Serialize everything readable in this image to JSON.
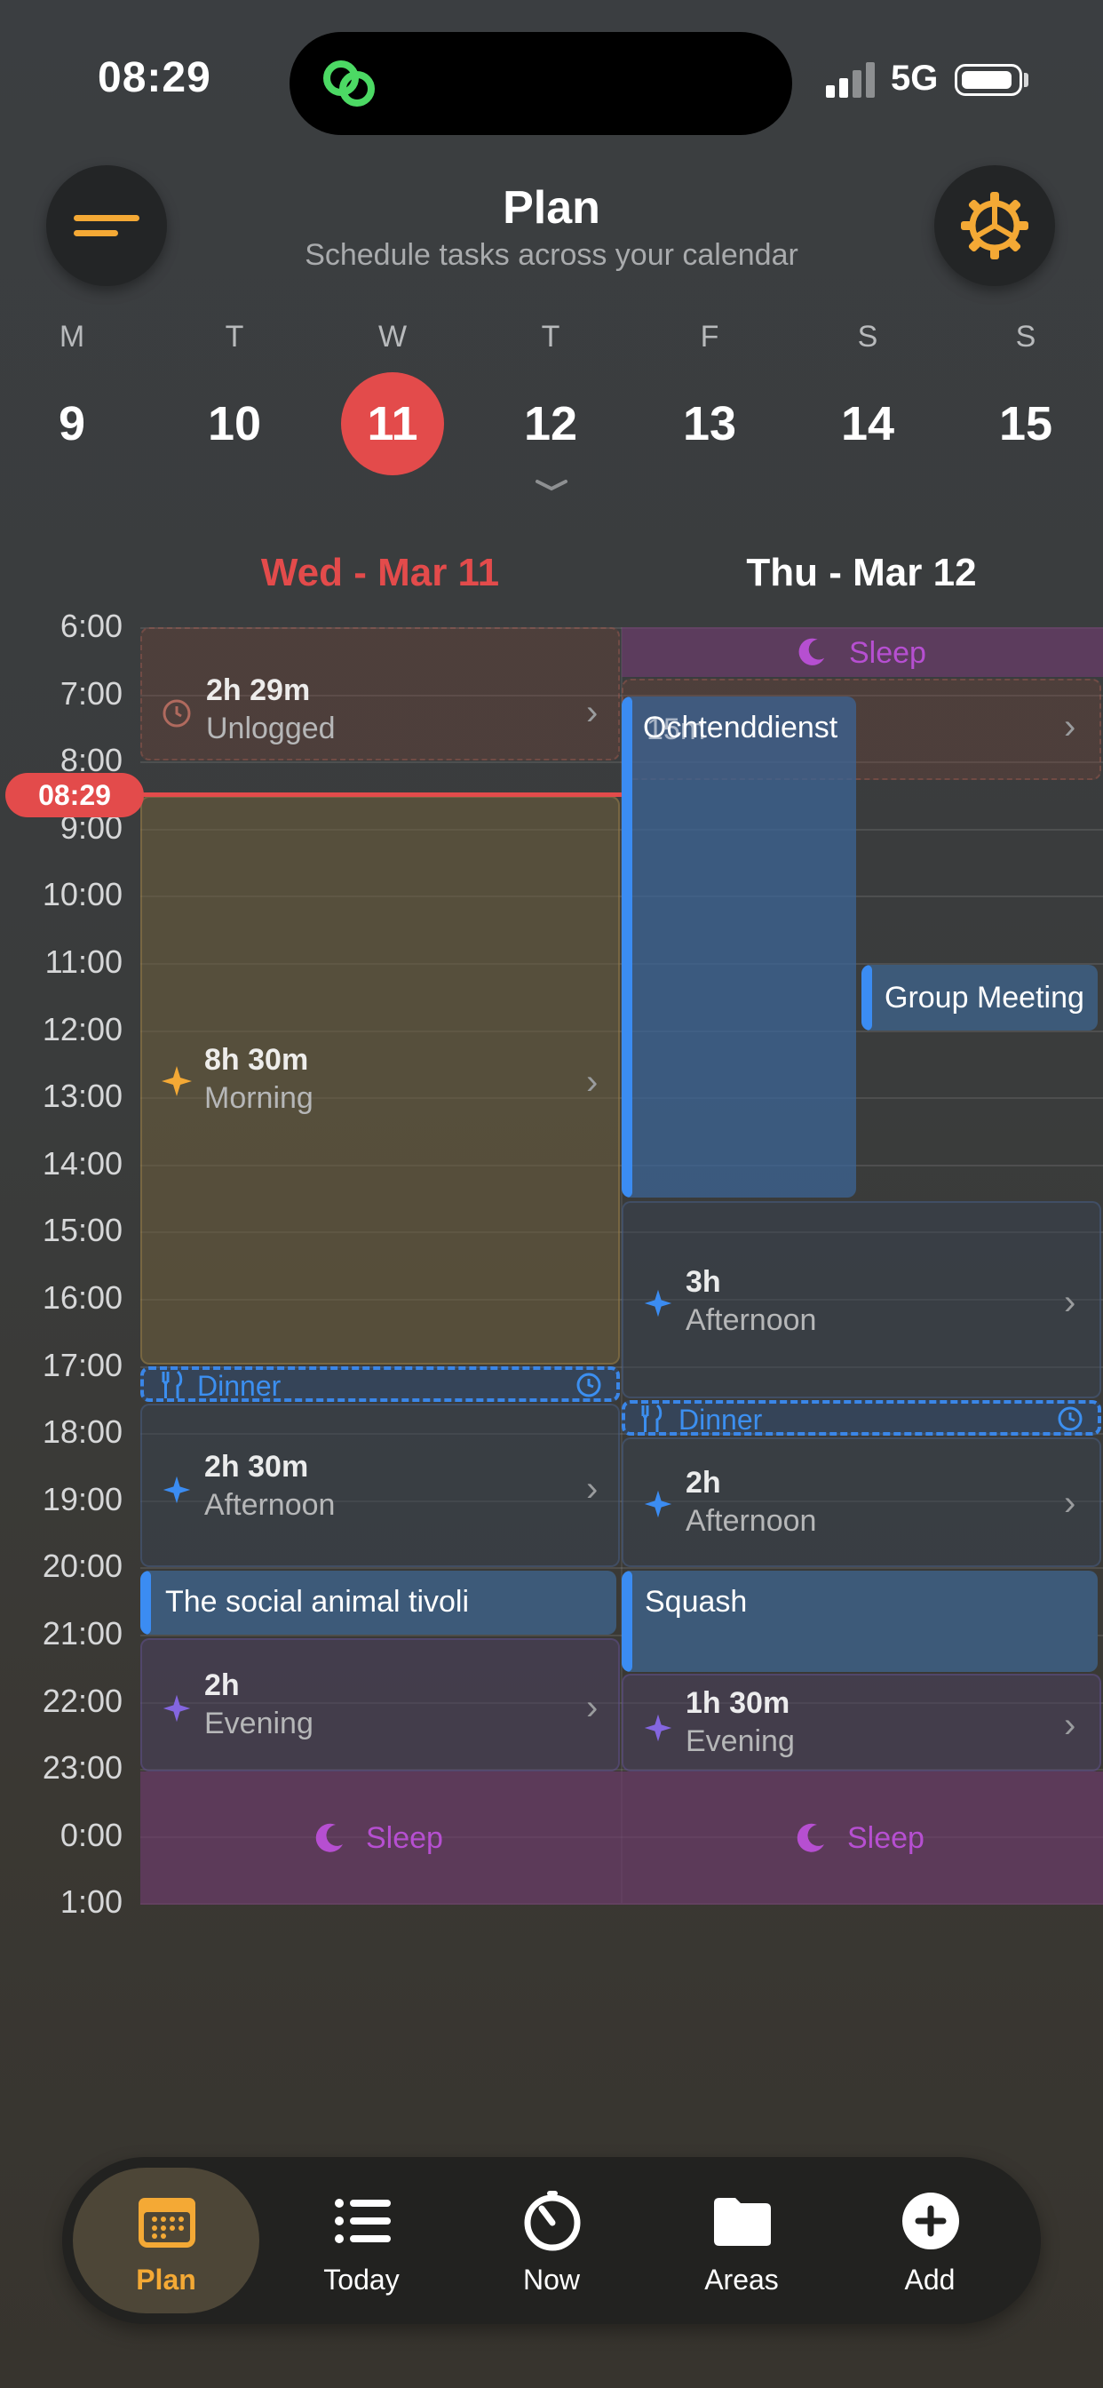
{
  "status": {
    "time": "08:29",
    "network": "5G"
  },
  "header": {
    "title": "Plan",
    "subtitle": "Schedule tasks across your calendar",
    "menu_icon": "menu-icon",
    "settings_icon": "gear-icon"
  },
  "week": [
    {
      "letter": "M",
      "num": "9"
    },
    {
      "letter": "T",
      "num": "10"
    },
    {
      "letter": "W",
      "num": "11",
      "selected": true
    },
    {
      "letter": "T",
      "num": "12"
    },
    {
      "letter": "F",
      "num": "13"
    },
    {
      "letter": "S",
      "num": "14"
    },
    {
      "letter": "S",
      "num": "15"
    }
  ],
  "days": {
    "left": "Wed - Mar 11",
    "right": "Thu - Mar 12"
  },
  "hours": [
    "6:00",
    "7:00",
    "8:00",
    "9:00",
    "10:00",
    "11:00",
    "12:00",
    "13:00",
    "14:00",
    "15:00",
    "16:00",
    "17:00",
    "18:00",
    "19:00",
    "20:00",
    "21:00",
    "22:00",
    "23:00",
    "0:00",
    "1:00"
  ],
  "now": "08:29",
  "wed": {
    "unlogged": {
      "duration": "2h 29m",
      "label": "Unlogged"
    },
    "morning": {
      "duration": "8h 30m",
      "label": "Morning"
    },
    "dinner": "Dinner",
    "afternoon": {
      "duration": "2h 30m",
      "label": "Afternoon"
    },
    "event": "The social animal tivoli",
    "evening": {
      "duration": "2h",
      "label": "Evening"
    },
    "sleep": "Sleep"
  },
  "thu": {
    "sleep_top": "Sleep",
    "event_long": "Ochtenddienst",
    "event_overlap": "15m",
    "group_meeting": "Group Meeting",
    "afternoon1": {
      "duration": "3h",
      "label": "Afternoon"
    },
    "dinner": "Dinner",
    "afternoon2": {
      "duration": "2h",
      "label": "Afternoon"
    },
    "event": "Squash",
    "evening": {
      "duration": "1h 30m",
      "label": "Evening"
    },
    "sleep": "Sleep"
  },
  "tabs": [
    {
      "label": "Plan",
      "icon": "calendar-icon",
      "selected": true
    },
    {
      "label": "Today",
      "icon": "list-icon"
    },
    {
      "label": "Now",
      "icon": "timer-icon"
    },
    {
      "label": "Areas",
      "icon": "folder-icon"
    },
    {
      "label": "Add",
      "icon": "plus-circle-icon"
    }
  ],
  "colors": {
    "accent": "#e34b4b",
    "brand": "#f4a935",
    "event": "#3b8cf2",
    "sleep": "#b64fd1"
  }
}
